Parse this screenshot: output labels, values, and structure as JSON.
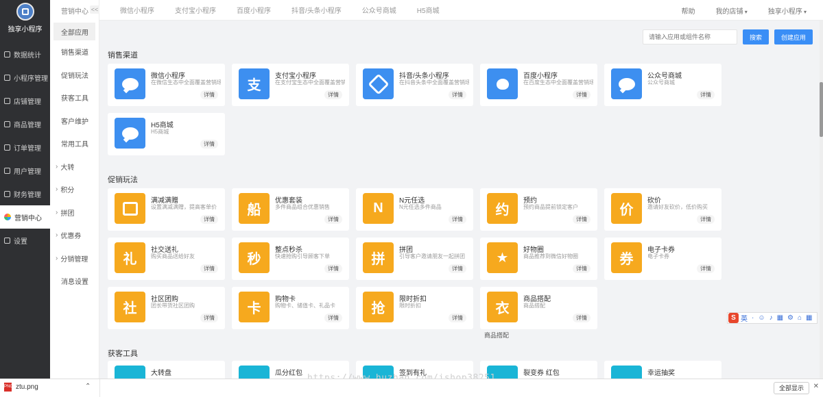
{
  "brand": {
    "name": "独享小程序"
  },
  "sidebar": {
    "items": [
      {
        "label": "数据统计",
        "icon": "chart-icon"
      },
      {
        "label": "小程序管理",
        "icon": "link-icon"
      },
      {
        "label": "店铺管理",
        "icon": "store-icon"
      },
      {
        "label": "商品管理",
        "icon": "goods-icon"
      },
      {
        "label": "订单管理",
        "icon": "order-icon"
      },
      {
        "label": "用户管理",
        "icon": "user-icon"
      },
      {
        "label": "财务管理",
        "icon": "finance-icon"
      },
      {
        "label": "营销中心",
        "icon": "marketing-icon",
        "active": true
      },
      {
        "label": "设置",
        "icon": "settings-icon"
      }
    ]
  },
  "submenu": {
    "header": "营销中心",
    "collapse": "<<",
    "items": [
      {
        "label": "全部应用",
        "active": true
      },
      {
        "label": "销售渠道"
      },
      {
        "label": "促销玩法"
      },
      {
        "label": "获客工具"
      },
      {
        "label": "客户维护"
      },
      {
        "label": "常用工具"
      },
      {
        "label": "大转",
        "group": true
      },
      {
        "label": "积分",
        "group": true
      },
      {
        "label": "拼团",
        "group": true
      },
      {
        "label": "优惠券",
        "group": true
      },
      {
        "label": "分销管理",
        "group": true
      },
      {
        "label": "消息设置"
      }
    ]
  },
  "topbar": {
    "tabs": [
      "微信小程序",
      "支付宝小程序",
      "百度小程序",
      "抖音/头条小程序",
      "公众号商城",
      "H5商城"
    ],
    "right": [
      "帮助",
      "我的店铺",
      "独享小程序"
    ]
  },
  "search": {
    "placeholder": "请输入应用或组件名称",
    "button": "搜索",
    "create_button": "创建应用"
  },
  "sections": [
    {
      "title": "销售渠道",
      "cards": [
        {
          "name": "微信小程序",
          "desc": "在微信生态中全面覆盖营销场景",
          "detail": "详情",
          "glyph": "bubble",
          "color": "blue"
        },
        {
          "name": "支付宝小程序",
          "desc": "在支付宝生态中全面覆盖营销场景",
          "detail": "详情",
          "glyph": "支",
          "color": "blue"
        },
        {
          "name": "抖音/头条小程序",
          "desc": "在抖音头条中全面覆盖营销场景",
          "detail": "详情",
          "glyph": "ring",
          "color": "blue"
        },
        {
          "name": "百度小程序",
          "desc": "在百度生态中全面覆盖营销场景",
          "detail": "详情",
          "glyph": "paw",
          "color": "blue"
        },
        {
          "name": "公众号商城",
          "desc": "公众号商城",
          "detail": "详情",
          "glyph": "bubble",
          "color": "blue"
        },
        {
          "name": "H5商城",
          "desc": "H5商城",
          "detail": "详情",
          "glyph": "bubble",
          "color": "blue"
        }
      ]
    },
    {
      "title": "促销玩法",
      "cards": [
        {
          "name": "满减满赠",
          "desc": "设置满减满赠，提高客单价",
          "detail": "详情",
          "glyph": "box",
          "color": "orange"
        },
        {
          "name": "优惠套装",
          "desc": "多件商品组合优惠销售",
          "detail": "详情",
          "glyph": "船",
          "color": "orange"
        },
        {
          "name": "N元任选",
          "desc": "N元任选多件商品",
          "detail": "详情",
          "glyph": "N",
          "color": "orange"
        },
        {
          "name": "预约",
          "desc": "预约商品提前锁定客户",
          "detail": "详情",
          "glyph": "约",
          "color": "orange"
        },
        {
          "name": "砍价",
          "desc": "邀请好友砍价，低价购买",
          "detail": "详情",
          "glyph": "价",
          "color": "orange"
        },
        {
          "name": "社交送礼",
          "desc": "购买商品送给好友",
          "detail": "详情",
          "glyph": "礼",
          "color": "orange"
        },
        {
          "name": "整点秒杀",
          "desc": "快速抢购引导顾客下单",
          "detail": "详情",
          "glyph": "秒",
          "color": "orange"
        },
        {
          "name": "拼团",
          "desc": "引导客户邀请朋友一起拼团",
          "detail": "详情",
          "glyph": "拼",
          "color": "orange"
        },
        {
          "name": "好物圈",
          "desc": "商品推荐到微信好物圈",
          "detail": "详情",
          "glyph": "★",
          "color": "orange"
        },
        {
          "name": "电子卡券",
          "desc": "电子卡券",
          "detail": "详情",
          "glyph": "券",
          "color": "orange"
        },
        {
          "name": "社区团购",
          "desc": "团长带货社区团购",
          "detail": "详情",
          "glyph": "社",
          "color": "orange"
        },
        {
          "name": "购物卡",
          "desc": "购物卡、储值卡、礼品卡",
          "detail": "详情",
          "glyph": "卡",
          "color": "orange"
        },
        {
          "name": "限时折扣",
          "desc": "限时折扣",
          "detail": "详情",
          "glyph": "抢",
          "color": "orange"
        },
        {
          "name": "商品搭配",
          "desc": "商品搭配",
          "detail": "详情",
          "glyph": "衣",
          "color": "orange",
          "extra": "商品搭配"
        }
      ]
    },
    {
      "title": "获客工具",
      "cards": [
        {
          "name": "大转盘",
          "desc": "",
          "detail": "",
          "glyph": "",
          "color": "teal"
        },
        {
          "name": "瓜分红包",
          "desc": "",
          "detail": "",
          "glyph": "",
          "color": "teal"
        },
        {
          "name": "签到有礼",
          "desc": "",
          "detail": "",
          "glyph": "",
          "color": "teal"
        },
        {
          "name": "裂变券 红包",
          "desc": "",
          "detail": "",
          "glyph": "",
          "color": "teal"
        },
        {
          "name": "幸运抽奖",
          "desc": "",
          "detail": "",
          "glyph": "",
          "color": "teal"
        }
      ]
    }
  ],
  "ime": {
    "items": [
      "英",
      "·",
      "☺",
      "♪",
      "▦",
      "⚙",
      "⌂",
      "▦"
    ]
  },
  "watermark": "https://www.huzhan.com/ishop38251",
  "download": {
    "file": "ztu.png",
    "show_all": "全部显示",
    "close": "✕"
  }
}
